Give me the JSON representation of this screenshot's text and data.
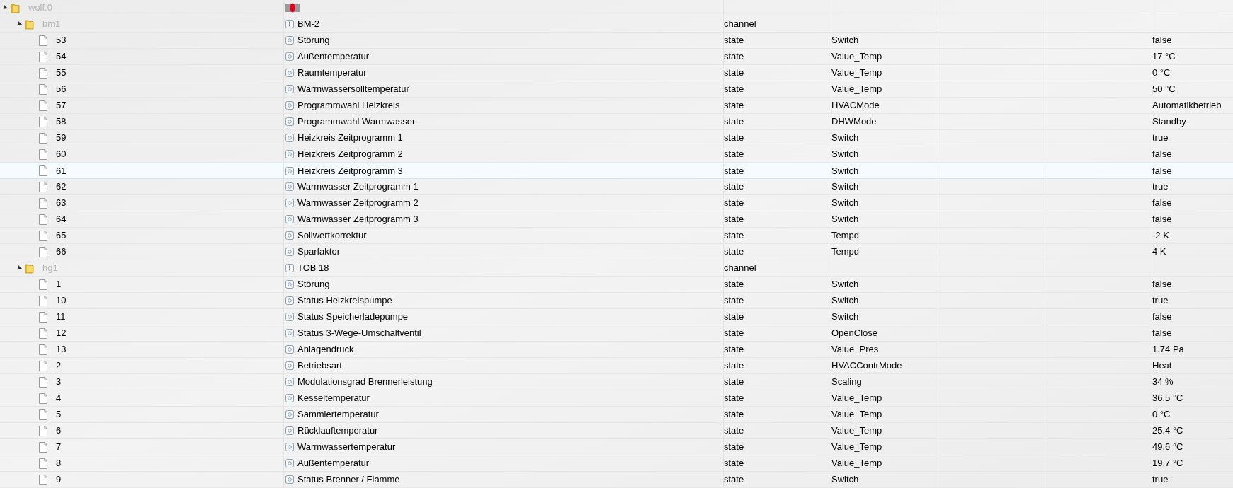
{
  "tree": [
    {
      "label": "wolf.0",
      "kind": "adapter",
      "expanded": true,
      "selected": false,
      "children": [
        {
          "label": "bm1",
          "kind": "folder",
          "expanded": true,
          "selected": false,
          "name": "BM-2",
          "type": "channel",
          "children": [
            {
              "label": "53",
              "kind": "state",
              "selected": false,
              "name": "Störung",
              "type": "state",
              "role": "Switch",
              "value": "false"
            },
            {
              "label": "54",
              "kind": "state",
              "selected": false,
              "name": "Außentemperatur",
              "type": "state",
              "role": "Value_Temp",
              "value": "17 °C"
            },
            {
              "label": "55",
              "kind": "state",
              "selected": false,
              "name": "Raumtemperatur",
              "type": "state",
              "role": "Value_Temp",
              "value": "0 °C"
            },
            {
              "label": "56",
              "kind": "state",
              "selected": false,
              "name": "Warmwassersolltemperatur",
              "type": "state",
              "role": "Value_Temp",
              "value": "50 °C"
            },
            {
              "label": "57",
              "kind": "state",
              "selected": false,
              "name": "Programmwahl Heizkreis",
              "type": "state",
              "role": "HVACMode",
              "value": "Automatikbetrieb"
            },
            {
              "label": "58",
              "kind": "state",
              "selected": false,
              "name": "Programmwahl Warmwasser",
              "type": "state",
              "role": "DHWMode",
              "value": "Standby"
            },
            {
              "label": "59",
              "kind": "state",
              "selected": false,
              "name": "Heizkreis Zeitprogramm 1",
              "type": "state",
              "role": "Switch",
              "value": "true"
            },
            {
              "label": "60",
              "kind": "state",
              "selected": false,
              "name": "Heizkreis Zeitprogramm 2",
              "type": "state",
              "role": "Switch",
              "value": "false"
            },
            {
              "label": "61",
              "kind": "state",
              "selected": true,
              "name": "Heizkreis Zeitprogramm 3",
              "type": "state",
              "role": "Switch",
              "value": "false"
            },
            {
              "label": "62",
              "kind": "state",
              "selected": false,
              "name": "Warmwasser Zeitprogramm 1",
              "type": "state",
              "role": "Switch",
              "value": "true"
            },
            {
              "label": "63",
              "kind": "state",
              "selected": false,
              "name": "Warmwasser Zeitprogramm 2",
              "type": "state",
              "role": "Switch",
              "value": "false"
            },
            {
              "label": "64",
              "kind": "state",
              "selected": false,
              "name": "Warmwasser Zeitprogramm 3",
              "type": "state",
              "role": "Switch",
              "value": "false"
            },
            {
              "label": "65",
              "kind": "state",
              "selected": false,
              "name": "Sollwertkorrektur",
              "type": "state",
              "role": "Tempd",
              "value": "-2 K"
            },
            {
              "label": "66",
              "kind": "state",
              "selected": false,
              "name": "Sparfaktor",
              "type": "state",
              "role": "Tempd",
              "value": "4 K"
            }
          ]
        },
        {
          "label": "hg1",
          "kind": "folder",
          "expanded": true,
          "selected": false,
          "name": "TOB 18",
          "type": "channel",
          "children": [
            {
              "label": "1",
              "kind": "state",
              "selected": false,
              "name": "Störung",
              "type": "state",
              "role": "Switch",
              "value": "false"
            },
            {
              "label": "10",
              "kind": "state",
              "selected": false,
              "name": "Status Heizkreispumpe",
              "type": "state",
              "role": "Switch",
              "value": "true"
            },
            {
              "label": "11",
              "kind": "state",
              "selected": false,
              "name": "Status Speicherladepumpe",
              "type": "state",
              "role": "Switch",
              "value": "false"
            },
            {
              "label": "12",
              "kind": "state",
              "selected": false,
              "name": "Status 3-Wege-Umschaltventil",
              "type": "state",
              "role": "OpenClose",
              "value": "false"
            },
            {
              "label": "13",
              "kind": "state",
              "selected": false,
              "name": "Anlagendruck",
              "type": "state",
              "role": "Value_Pres",
              "value": "1.74 Pa"
            },
            {
              "label": "2",
              "kind": "state",
              "selected": false,
              "name": "Betriebsart",
              "type": "state",
              "role": "HVACContrMode",
              "value": "Heat"
            },
            {
              "label": "3",
              "kind": "state",
              "selected": false,
              "name": "Modulationsgrad Brennerleistung",
              "type": "state",
              "role": "Scaling",
              "value": "34 %"
            },
            {
              "label": "4",
              "kind": "state",
              "selected": false,
              "name": "Kesseltemperatur",
              "type": "state",
              "role": "Value_Temp",
              "value": "36.5 °C"
            },
            {
              "label": "5",
              "kind": "state",
              "selected": false,
              "name": "Sammlertemperatur",
              "type": "state",
              "role": "Value_Temp",
              "value": "0 °C"
            },
            {
              "label": "6",
              "kind": "state",
              "selected": false,
              "name": "Rücklauftemperatur",
              "type": "state",
              "role": "Value_Temp",
              "value": "25.4 °C"
            },
            {
              "label": "7",
              "kind": "state",
              "selected": false,
              "name": "Warmwassertemperatur",
              "type": "state",
              "role": "Value_Temp",
              "value": "49.6 °C"
            },
            {
              "label": "8",
              "kind": "state",
              "selected": false,
              "name": "Außentemperatur",
              "type": "state",
              "role": "Value_Temp",
              "value": "19.7 °C"
            },
            {
              "label": "9",
              "kind": "state",
              "selected": false,
              "name": "Status Brenner / Flamme",
              "type": "state",
              "role": "Switch",
              "value": "true"
            }
          ]
        }
      ]
    }
  ]
}
